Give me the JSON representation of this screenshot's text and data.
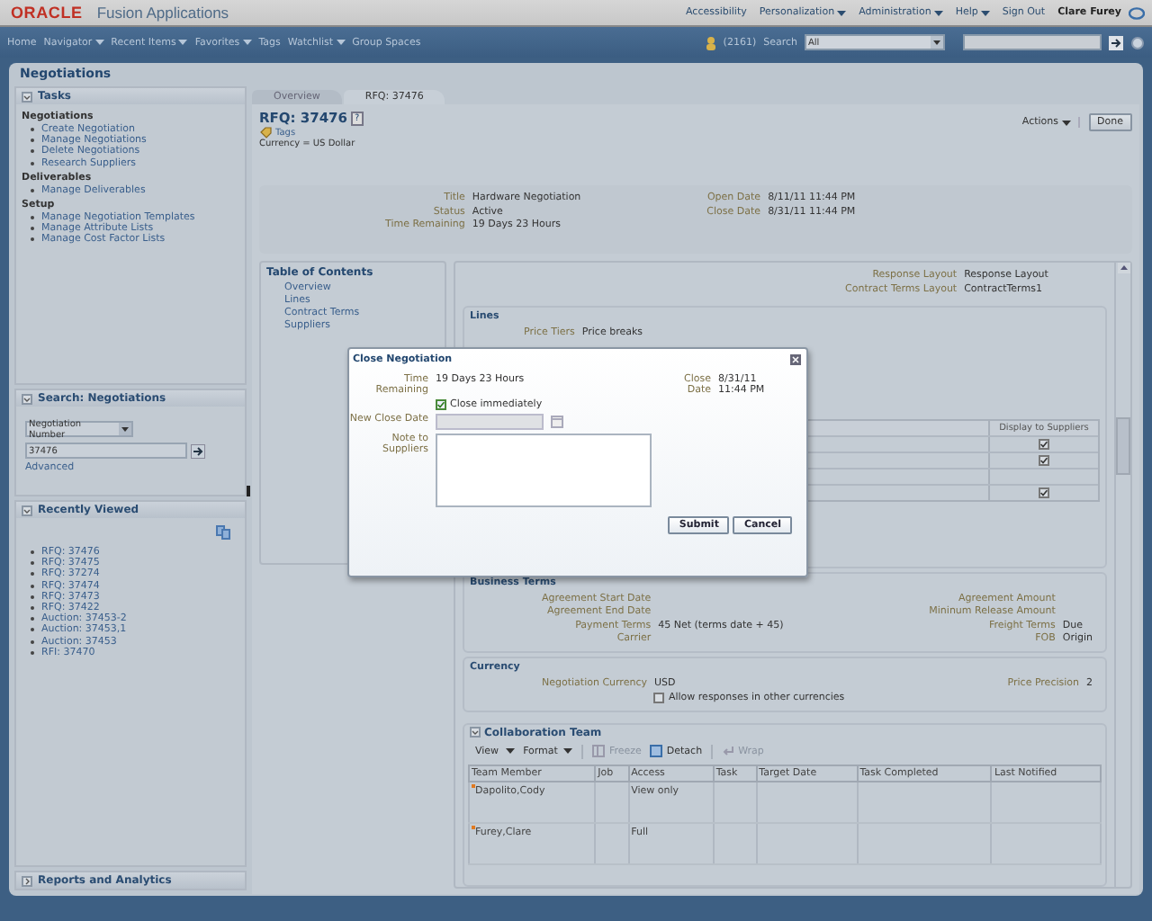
{
  "header": {
    "logo": "ORACLE",
    "product": "Fusion Applications",
    "links": [
      {
        "label": "Accessibility",
        "menu": false
      },
      {
        "label": "Personalization",
        "menu": true
      },
      {
        "label": "Administration",
        "menu": true
      },
      {
        "label": "Help",
        "menu": true
      },
      {
        "label": "Sign Out",
        "menu": false
      }
    ],
    "user": "Clare Furey"
  },
  "navbar": {
    "items": [
      {
        "label": "Home",
        "menu": false
      },
      {
        "label": "Navigator",
        "menu": true
      },
      {
        "label": "Recent Items",
        "menu": true
      },
      {
        "label": "Favorites",
        "menu": true
      },
      {
        "label": "Tags",
        "menu": false
      },
      {
        "label": "Watchlist",
        "menu": true
      },
      {
        "label": "Group Spaces",
        "menu": false
      }
    ],
    "notifications": "(2161)",
    "search_label": "Search",
    "search_scope": "All"
  },
  "page_title": "Negotiations",
  "tasks": {
    "title": "Tasks",
    "expanded": true,
    "groups": [
      {
        "heading": "Negotiations",
        "items": [
          "Create Negotiation",
          "Manage Negotiations",
          "Delete Negotiations",
          "Research Suppliers"
        ]
      },
      {
        "heading": "Deliverables",
        "items": [
          "Manage Deliverables"
        ]
      },
      {
        "heading": "Setup",
        "items": [
          "Manage Negotiation Templates",
          "Manage Attribute Lists",
          "Manage Cost Factor Lists"
        ]
      }
    ]
  },
  "search_panel": {
    "title": "Search: Negotiations",
    "expanded": true,
    "field_select": "Negotiation Number",
    "value": "37476",
    "advanced": "Advanced"
  },
  "recently_viewed": {
    "title": "Recently Viewed",
    "expanded": true,
    "items": [
      "RFQ: 37476",
      "RFQ: 37475",
      "RFQ: 37274",
      "RFQ: 37474",
      "RFQ: 37473",
      "RFQ: 37422",
      "Auction: 37453-2",
      "Auction: 37453,1",
      "Auction: 37453",
      "RFI: 37470"
    ]
  },
  "reports": {
    "title": "Reports and Analytics",
    "expanded": false
  },
  "tabs": [
    {
      "label": "Overview",
      "selected": false
    },
    {
      "label": "RFQ: 37476",
      "selected": true
    }
  ],
  "document": {
    "title": "RFQ: 37476",
    "help": "?",
    "tags": "Tags",
    "currency": "Currency = US Dollar",
    "actions": "Actions",
    "done": "Done"
  },
  "summary": {
    "left": [
      {
        "label": "Title",
        "value": "Hardware Negotiation"
      },
      {
        "label": "Status",
        "value": "Active"
      },
      {
        "label": "Time Remaining",
        "value": "19 Days 23 Hours"
      }
    ],
    "right": [
      {
        "label": "Open Date",
        "value": "8/11/11 11:44 PM"
      },
      {
        "label": "Close Date",
        "value": "8/31/11 11:44 PM"
      }
    ]
  },
  "toc": {
    "title": "Table of Contents",
    "items": [
      "Overview",
      "Lines",
      "Contract Terms",
      "Suppliers"
    ]
  },
  "layouts": [
    {
      "label": "Response Layout",
      "value": "Response Layout"
    },
    {
      "label": "Contract Terms Layout",
      "value": "ContractTerms1"
    }
  ],
  "lines": {
    "title": "Lines",
    "price_tiers_label": "Price Tiers",
    "price_tiers": "Price breaks",
    "column": "Display to Suppliers",
    "rows": [
      {
        "kind": "checkbox",
        "checked": true
      },
      {
        "kind": "checkbox",
        "checked": true
      },
      {
        "kind": "blank"
      },
      {
        "kind": "checkbox",
        "checked": true
      }
    ]
  },
  "business_terms": {
    "title": "Business Terms",
    "left": [
      {
        "label": "Agreement Start Date"
      },
      {
        "label": "Agreement End Date"
      },
      {
        "label": "Payment Terms",
        "value": "45 Net (terms date + 45)"
      },
      {
        "label": "Carrier"
      }
    ],
    "right": [
      {
        "label": "Agreement Amount"
      },
      {
        "label": "Mininum Release Amount"
      },
      {
        "label": "Freight Terms",
        "value": "Due"
      },
      {
        "label": "FOB",
        "value": "Origin"
      }
    ]
  },
  "currency": {
    "title": "Currency",
    "label": "Negotiation Currency",
    "value": "USD",
    "allow": {
      "label": "Allow responses in other currencies",
      "checked": false
    },
    "precision_label": "Price Precision",
    "precision": "2"
  },
  "team": {
    "title": "Collaboration Team",
    "expanded": true,
    "toolbar": [
      {
        "label": "View",
        "kind": "menu",
        "disabled": false
      },
      {
        "label": "Format",
        "kind": "menu",
        "disabled": false
      },
      {
        "label": "Freeze",
        "kind": "freeze",
        "disabled": true
      },
      {
        "label": "Detach",
        "kind": "detach",
        "disabled": false
      },
      {
        "label": "Wrap",
        "kind": "wrap",
        "disabled": true
      }
    ],
    "columns": [
      "Team Member",
      "Job",
      "Access",
      "Task",
      "Target Date",
      "Task Completed",
      "Last Notified"
    ],
    "rows": [
      {
        "member": "Dapolito,Cody",
        "required": true,
        "access": "View only"
      },
      {
        "member": "Furey,Clare",
        "required": true,
        "access": "Full"
      }
    ]
  },
  "dialog": {
    "title": "Close Negotiation",
    "time_label": "Time Remaining",
    "time": "19 Days 23 Hours",
    "close_label": "Close Date",
    "close": "8/31/11 11:44 PM",
    "close_immediately": {
      "label": "Close immediately",
      "checked": true
    },
    "new_close_label": "New Close Date",
    "new_close_disabled": true,
    "note_label": "Note to Suppliers",
    "buttons": [
      "Submit",
      "Cancel"
    ]
  }
}
